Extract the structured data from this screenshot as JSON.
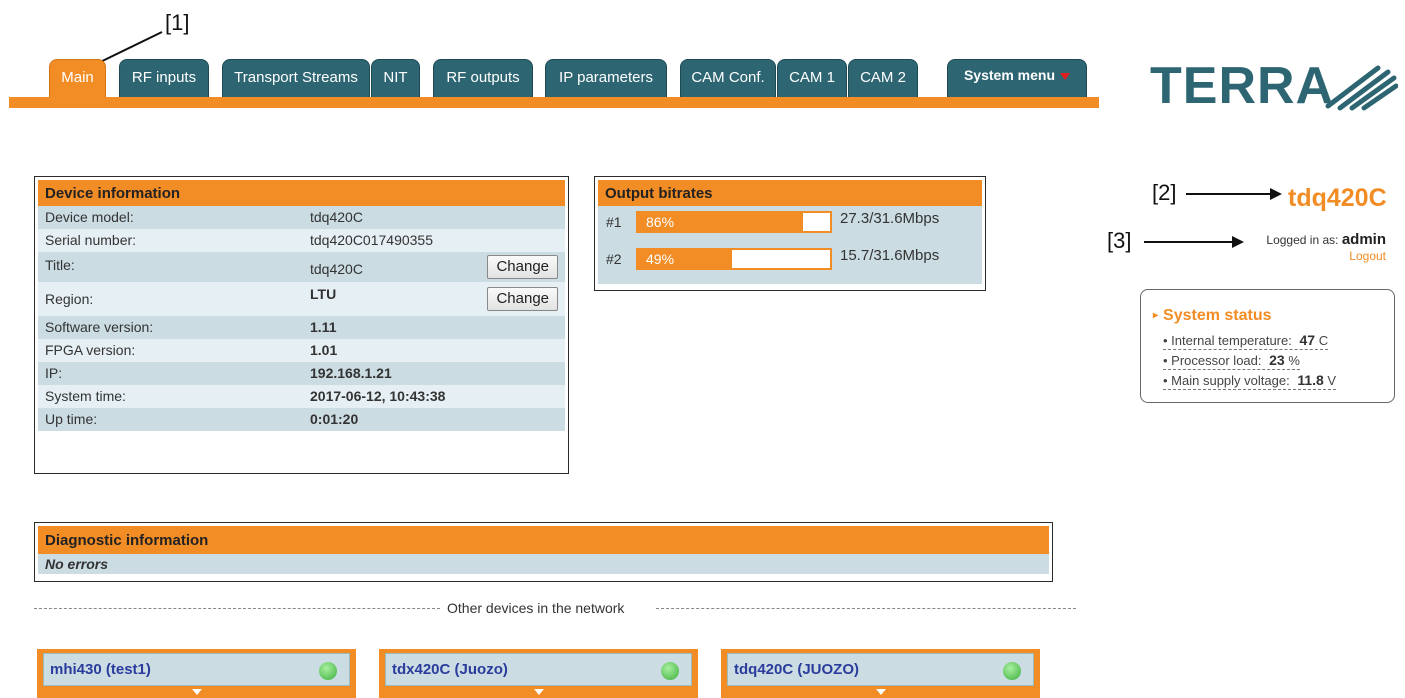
{
  "annotations": {
    "a1": "[1]",
    "a2": "[2]",
    "a3": "[3]"
  },
  "tabs": [
    {
      "label": "Main",
      "active": true
    },
    {
      "label": "RF inputs"
    },
    {
      "label": "Transport Streams"
    },
    {
      "label": "NIT"
    },
    {
      "label": "RF outputs"
    },
    {
      "label": "IP parameters"
    },
    {
      "label": "CAM Conf."
    },
    {
      "label": "CAM 1"
    },
    {
      "label": "CAM 2"
    },
    {
      "label": "System menu"
    }
  ],
  "logo": {
    "text": "TERRA"
  },
  "device_info": {
    "title": "Device information",
    "rows": [
      {
        "label": "Device model:",
        "value": "tdq420C"
      },
      {
        "label": "Serial number:",
        "value": "tdq420C017490355"
      },
      {
        "label": "Title:",
        "value": "tdq420C",
        "button": "Change"
      },
      {
        "label": "Region:",
        "value": "LTU",
        "button": "Change"
      },
      {
        "label": "Software version:",
        "value": "1.11"
      },
      {
        "label": "FPGA version:",
        "value": "1.01"
      },
      {
        "label": "IP:",
        "value": "192.168.1.21"
      },
      {
        "label": "System time:",
        "value": "2017-06-12, 10:43:38"
      },
      {
        "label": "Up time:",
        "value": "0:01:20"
      }
    ]
  },
  "output_bitrates": {
    "title": "Output bitrates",
    "rows": [
      {
        "num": "#1",
        "percent_label": "86%",
        "percent": 86,
        "rate": "27.3/31.6Mbps"
      },
      {
        "num": "#2",
        "percent_label": "49%",
        "percent": 49,
        "rate": "15.7/31.6Mbps"
      }
    ]
  },
  "user": {
    "device_name": "tdq420C",
    "logged_in_prefix": "Logged in as:",
    "username": "admin",
    "logout_label": "Logout"
  },
  "system_status": {
    "title": "System status",
    "items": [
      {
        "label": "Internal temperature:",
        "value": "47",
        "unit": "C"
      },
      {
        "label": "Processor load:",
        "value": "23",
        "unit": "%"
      },
      {
        "label": "Main supply voltage:",
        "value": "11.8",
        "unit": "V"
      }
    ]
  },
  "diagnostic": {
    "title": "Diagnostic information",
    "message": "No errors"
  },
  "other_devices": {
    "label": "Other devices in the network",
    "devices": [
      {
        "name": "mhi430 (test1)",
        "status_color": "#3cae3c"
      },
      {
        "name": "tdx420C (Juozo)",
        "status_color": "#3cae3c"
      },
      {
        "name": "tdq420C (JUOZO)",
        "status_color": "#3cae3c"
      }
    ]
  },
  "colors": {
    "accent": "#f28c25",
    "tab": "#2d6672",
    "row_dark": "#cbdce3",
    "row_light": "#e6eff3"
  }
}
